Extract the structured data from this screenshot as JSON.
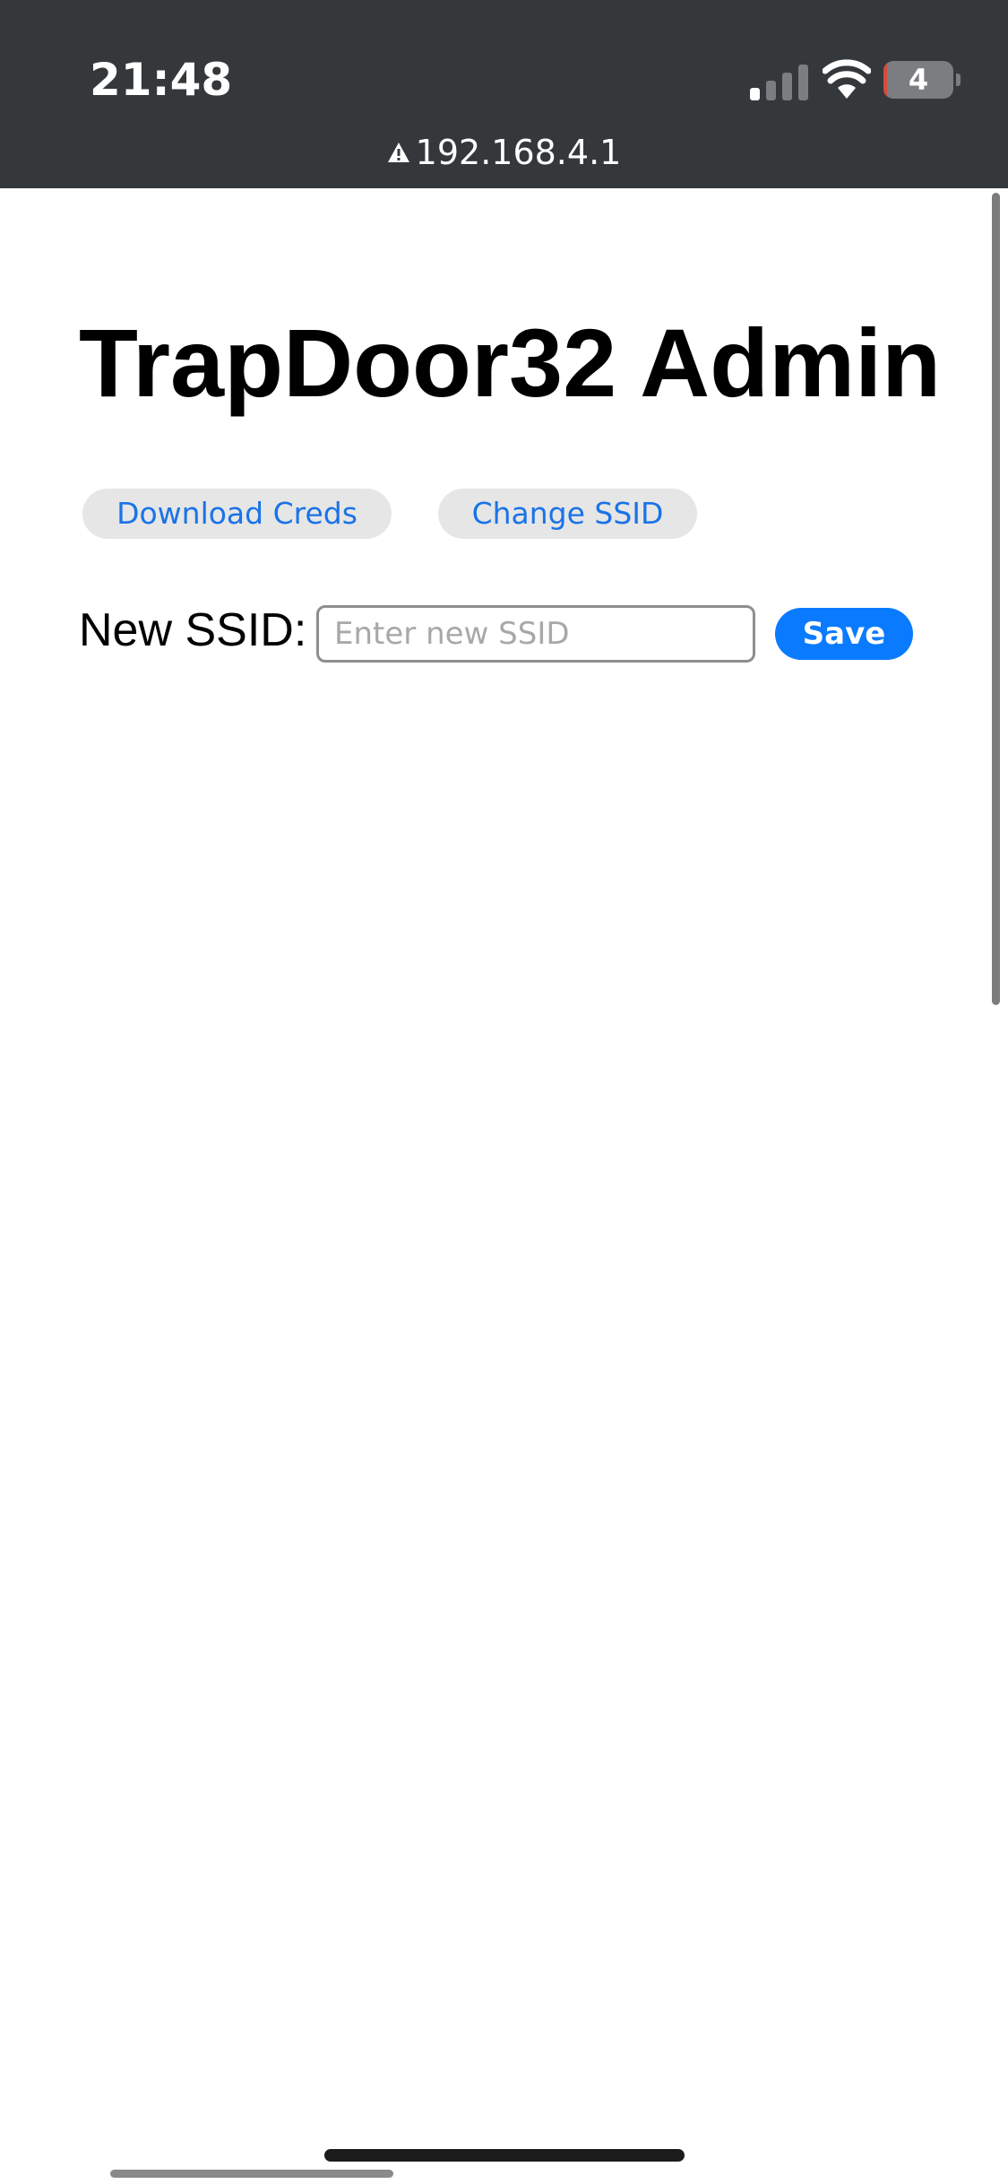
{
  "status_bar": {
    "time": "21:48",
    "battery_level": "4",
    "battery_fraction": 0.04,
    "signal_bars_active": 1,
    "signal_bars_total": 4,
    "background_color": "#35383b"
  },
  "browser": {
    "url": "192.168.4.1",
    "security_icon": "warning-icon"
  },
  "page": {
    "title": "TrapDoor32 Admin",
    "buttons": {
      "download_creds": "Download Creds",
      "change_ssid": "Change SSID"
    },
    "form": {
      "label": "New SSID:",
      "input_value": "",
      "input_placeholder": "Enter new SSID",
      "save_label": "Save"
    },
    "colors": {
      "link_blue": "#1a73e8",
      "save_blue": "#0a7bff",
      "pill_background": "#e6e6e6"
    }
  }
}
